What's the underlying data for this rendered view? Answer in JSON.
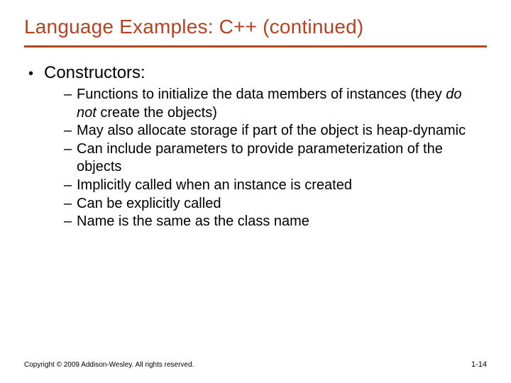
{
  "title": "Language Examples: C++ (continued)",
  "heading": "Constructors:",
  "bullets": {
    "b0a": "Functions to initialize the data members of instances (they ",
    "b0i": "do not",
    "b0b": " create the objects)",
    "b1": "May also allocate storage if part of the object is heap-dynamic",
    "b2": "Can include parameters to provide parameterization of the objects",
    "b3": "Implicitly called when an instance is created",
    "b4": "Can be explicitly called",
    "b5": "Name is the same as the class name"
  },
  "footer": {
    "copyright": "Copyright © 2009 Addison-Wesley. All rights reserved.",
    "page": "1-14"
  }
}
